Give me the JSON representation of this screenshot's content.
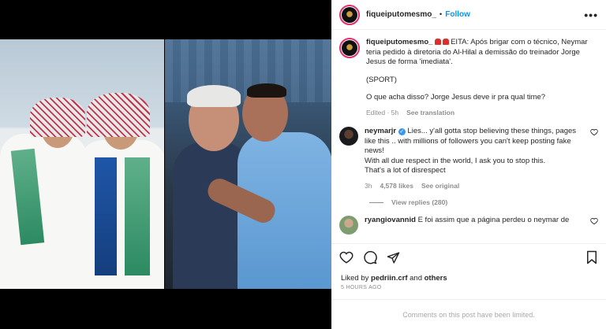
{
  "post": {
    "username": "fiqueiputomesmo_",
    "follow_label": "Follow",
    "more_label": "•••"
  },
  "caption": {
    "username": "fiqueiputomesmo_",
    "text_1": "EITA: Após brigar com o técnico, Neymar teria pedido à diretoria do Al-Hilal a demissão do treinador Jorge Jesus de forma 'imediata'.",
    "text_2": "(SPORT)",
    "text_3": "O que acha disso? Jorge Jesus deve ir pra qual time?",
    "edited": "Edited · 5h",
    "see_translation": "See translation"
  },
  "comments": [
    {
      "username": "neymarjr",
      "verified_mark": "✓",
      "line_1": "Lies... y'all gotta stop believing these things, pages like this .. with millions of followers you can't keep posting fake news!",
      "line_2": "With all due respect in the world, I ask you to stop this.",
      "line_3": "That's a lot of disrespect",
      "time": "3h",
      "likes": "4,578 likes",
      "see_original": "See original",
      "view_replies": "View replies (280)"
    },
    {
      "username": "ryangiovannid",
      "text": "E foi assim que a página perdeu o neymar de"
    }
  ],
  "likes_line": {
    "prefix": "Liked by",
    "user": "pedriin.crf",
    "and": "and",
    "others": "others"
  },
  "time_ago": "5 HOURS AGO",
  "comments_limited": "Comments on this post have been limited.",
  "colors": {
    "accent": "#0095f6",
    "muted": "#8e8e8e",
    "ring": "#e1306c"
  },
  "icons": [
    "heart-icon",
    "comment-icon",
    "share-icon",
    "bookmark-icon",
    "more-icon",
    "verified-icon"
  ]
}
